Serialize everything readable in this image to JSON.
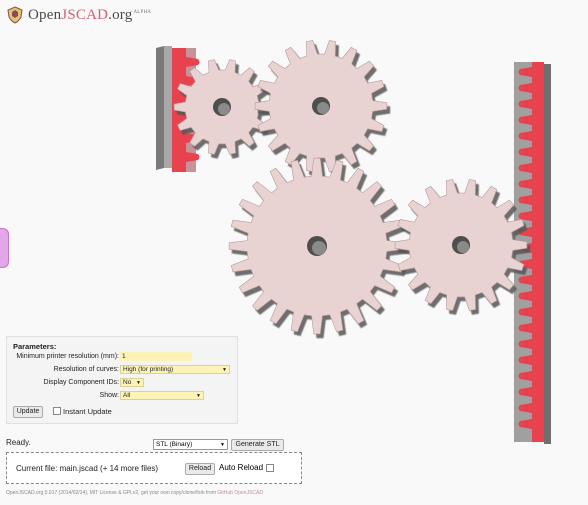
{
  "app": {
    "logo_text_prefix": "Open",
    "logo_text_brand": "JSCAD",
    "logo_text_suffix": ".org",
    "logo_badge": "ALPHA"
  },
  "viewer": {
    "gear_color": "#e8d2d2",
    "rack_color": "#e8424e",
    "rack_base_color": "#8c8c8c"
  },
  "parameters": {
    "title": "Parameters:",
    "rows": [
      {
        "label": "Minimum printer resolution (mm):",
        "value": "1"
      },
      {
        "label": "Resolution of curves:",
        "value": "High (for printing)"
      },
      {
        "label": "Display Component IDs:",
        "value": "No"
      },
      {
        "label": "Show:",
        "value": "All"
      }
    ],
    "update_button": "Update",
    "instant_update_label": "Instant Update"
  },
  "status": {
    "text": "Ready.",
    "format_selected": "STL (Binary)",
    "generate_button": "Generate STL"
  },
  "file": {
    "current_file": "Current file: main.jscad (+ 14 more files)",
    "reload_button": "Reload",
    "auto_reload_label": "Auto Reload"
  },
  "footer": {
    "text": "OpenJSCAD.org 0.017 (2014/02/14), MIT License & GPLv2, get your own copy/clone/fork from ",
    "link": "GitHub OpenJSCAD"
  }
}
